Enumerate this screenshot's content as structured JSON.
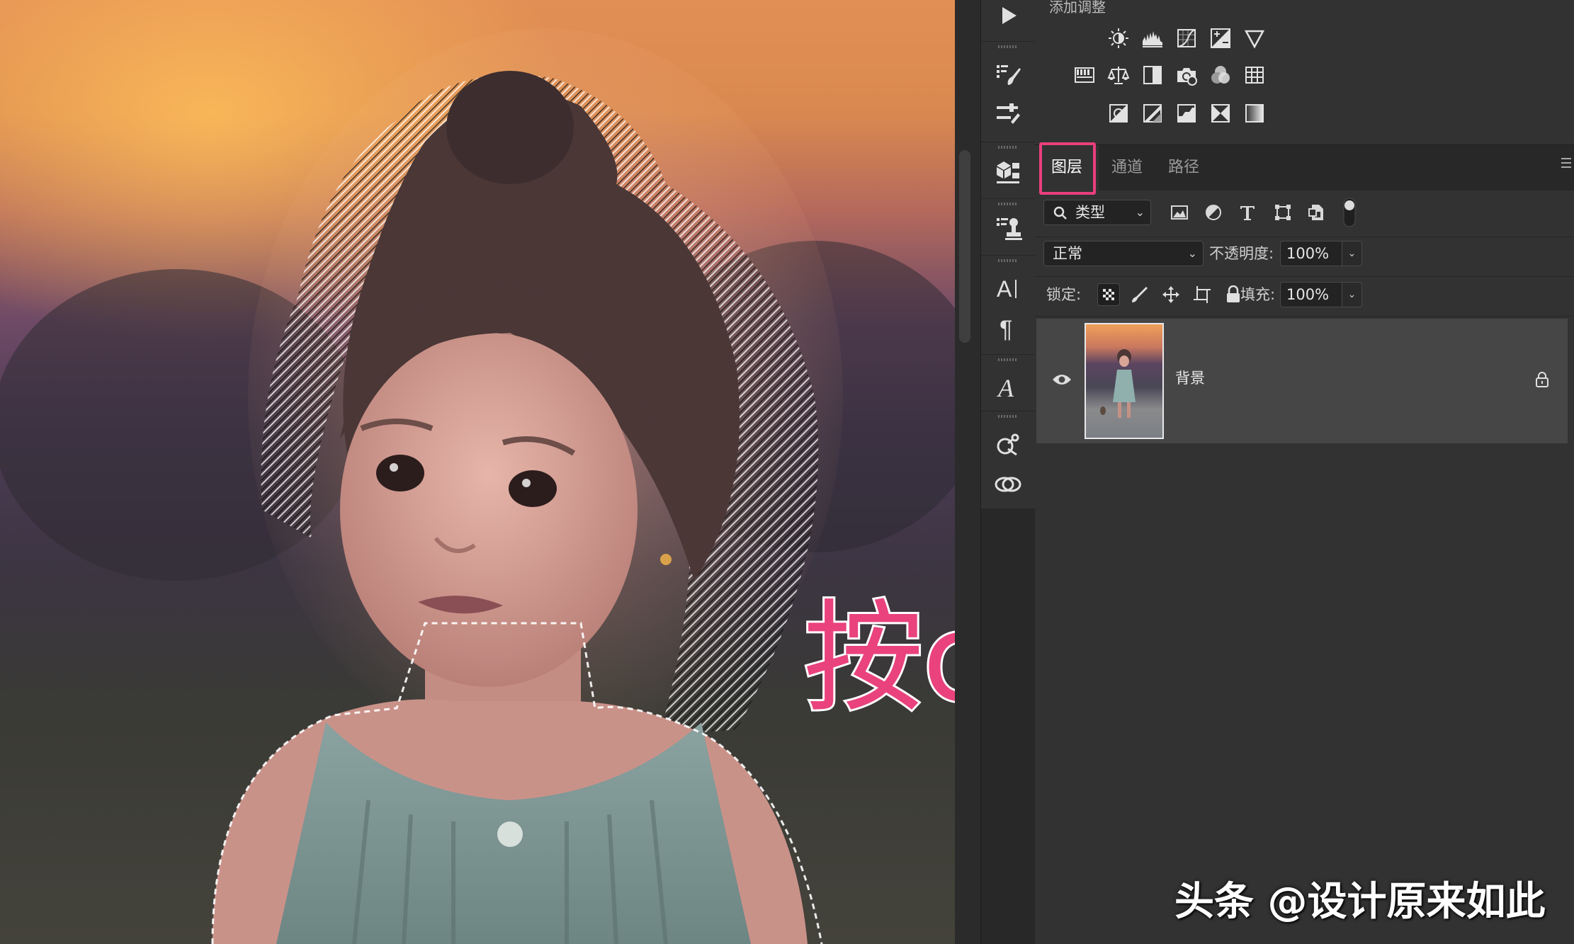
{
  "adjustments": {
    "title": "添加调整",
    "row1": [
      "brightness-contrast-icon",
      "levels-icon",
      "curves-icon",
      "exposure-icon",
      "vibrance-icon"
    ],
    "row2": [
      "hue-saturation-icon",
      "color-balance-icon",
      "black-white-icon",
      "photo-filter-icon",
      "channel-mixer-icon",
      "color-lookup-icon"
    ],
    "row3": [
      "invert-icon",
      "posterize-icon",
      "threshold-icon",
      "selective-color-icon",
      "gradient-map-icon"
    ]
  },
  "tabs": [
    {
      "label": "图层",
      "active": true
    },
    {
      "label": "通道",
      "active": false
    },
    {
      "label": "路径",
      "active": false
    }
  ],
  "filter": {
    "kind_label": "类型",
    "icons": [
      "pixel-layer-filter-icon",
      "adjustment-layer-filter-icon",
      "type-layer-filter-icon",
      "shape-layer-filter-icon",
      "smart-object-filter-icon"
    ]
  },
  "blend": {
    "mode": "正常",
    "opacity_label": "不透明度:",
    "opacity_value": "100%"
  },
  "lock": {
    "label": "锁定:",
    "fill_label": "填充:",
    "fill_value": "100%"
  },
  "layers": [
    {
      "name": "背景",
      "visible": true,
      "locked": true
    }
  ],
  "toolbar": {
    "icons": [
      "play-icon",
      "brush-settings-icon",
      "tool-presets-icon",
      "3d-icon",
      "clone-source-icon",
      "character-icon",
      "paragraph-icon",
      "glyphs-icon",
      "properties-icon",
      "libraries-icon"
    ]
  },
  "annotation": {
    "text": "按ctrl+J",
    "color": "#e9427d"
  },
  "watermark": {
    "text": "头条 @设计原来如此"
  },
  "colors": {
    "highlight": "#ea3f7c",
    "panel_bg": "#323232"
  }
}
